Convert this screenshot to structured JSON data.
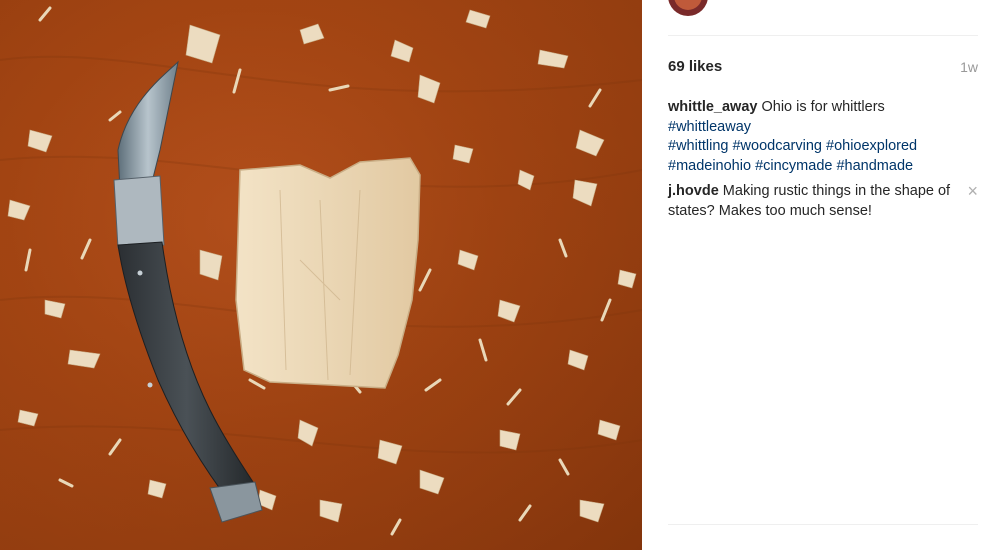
{
  "post": {
    "author": "whittle_away",
    "likes": "69 likes",
    "time": "1w"
  },
  "caption": {
    "username": "whittle_away",
    "text": "Ohio is for whittlers",
    "hashtags": [
      "#whittleaway",
      "#whittling",
      "#woodcarving",
      "#ohioexplored",
      "#madeinohio",
      "#cincymade",
      "#handmade"
    ]
  },
  "comments": [
    {
      "username": "j.hovde",
      "text": "Making rustic things in the shape of states? Makes too much sense!"
    }
  ],
  "icons": {
    "remove_comment": "close-icon"
  }
}
